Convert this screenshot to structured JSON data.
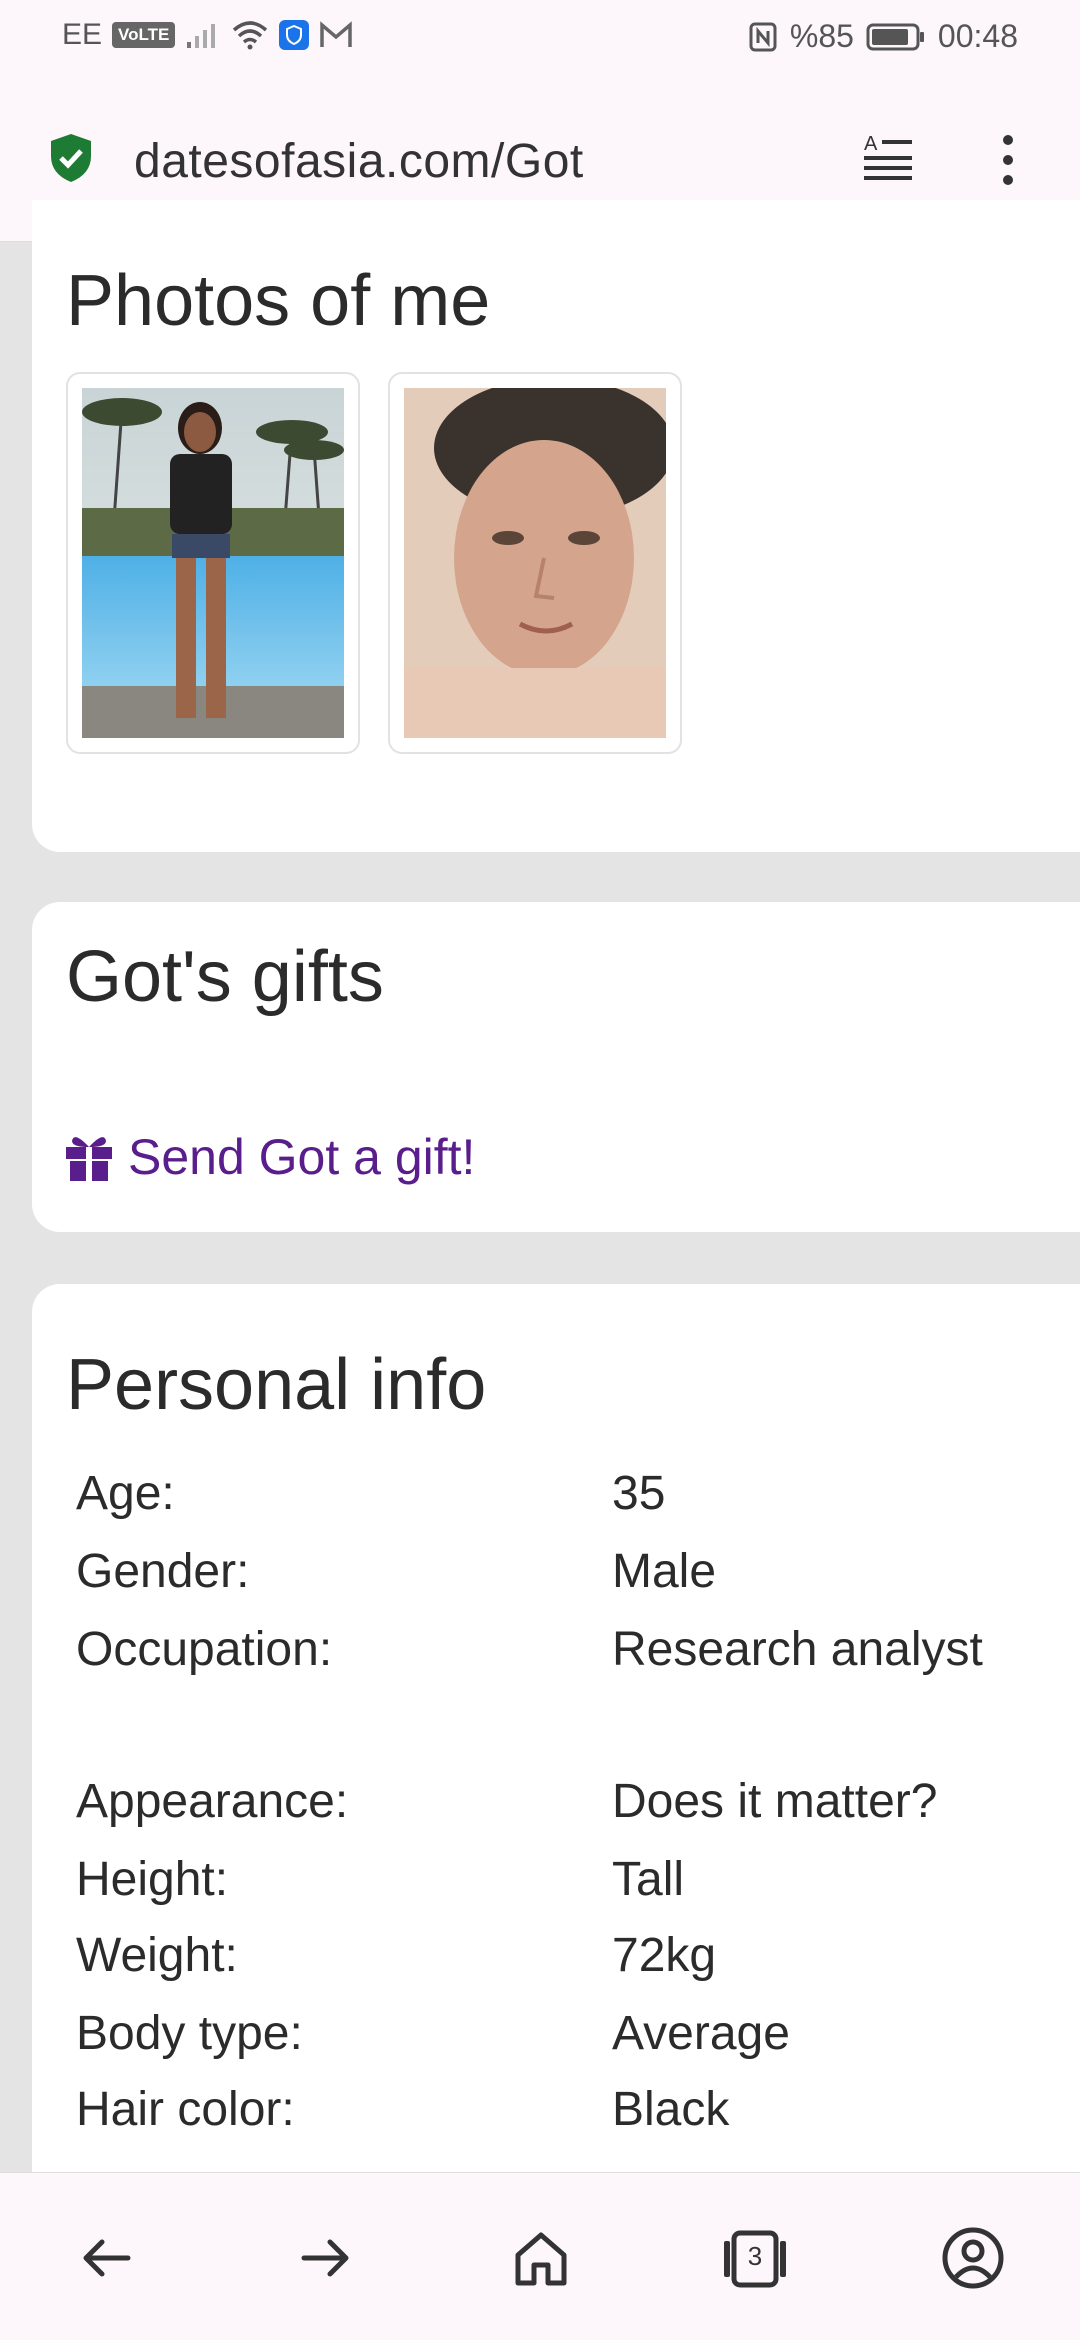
{
  "status_bar": {
    "carrier": "EE",
    "volte": "VoLTE",
    "battery": "%85",
    "time": "00:48"
  },
  "browser": {
    "url": "datesofasia.com/Got",
    "tab_count": "3"
  },
  "photos": {
    "title": "Photos of me"
  },
  "gifts": {
    "title": "Got's gifts",
    "send_link": "Send Got a gift!"
  },
  "personal_info": {
    "title": "Personal info",
    "rows": [
      {
        "label": "Age:",
        "value": "35"
      },
      {
        "label": "Gender:",
        "value": "Male"
      },
      {
        "label": "Occupation:",
        "value": "Research analyst"
      },
      {
        "label": "Appearance:",
        "value": "Does it matter?"
      },
      {
        "label": "Height:",
        "value": "Tall"
      },
      {
        "label": "Weight:",
        "value": "72kg"
      },
      {
        "label": "Body type:",
        "value": "Average"
      },
      {
        "label": "Hair color:",
        "value": "Black"
      }
    ]
  },
  "colors": {
    "link": "#5a1d8c",
    "shield_green": "#1e7b34",
    "background": "#e4e4e4"
  }
}
